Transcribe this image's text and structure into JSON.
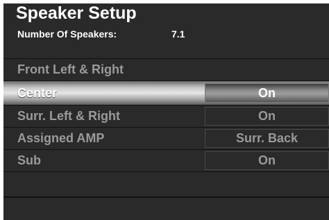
{
  "header": {
    "title": "Speaker Setup",
    "speaker_count_label": "Number Of Speakers:",
    "speaker_count_value": "7.1"
  },
  "rows": [
    {
      "label": "Front Left & Right",
      "value": null
    },
    {
      "label": "Center",
      "value": "On",
      "selected": true
    },
    {
      "label": "Surr. Left & Right",
      "value": "On"
    },
    {
      "label": "Assigned AMP",
      "value": "Surr. Back"
    },
    {
      "label": "Sub",
      "value": "On"
    }
  ],
  "colors": {
    "background": "#111111",
    "panel": "#2a2a2a",
    "text_dim": "#9a9a9a",
    "text_active": "#ffffff"
  }
}
